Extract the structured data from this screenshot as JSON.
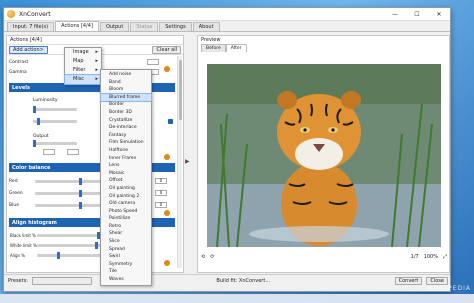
{
  "window": {
    "title": "XnConvert",
    "minimize": "—",
    "maximize": "☐",
    "close": "✕"
  },
  "tabs": [
    {
      "label": "Input: 7 file(s)"
    },
    {
      "label": "Actions [4/4]"
    },
    {
      "label": "Output"
    },
    {
      "label": "Status"
    },
    {
      "label": "Settings"
    },
    {
      "label": "About"
    }
  ],
  "actions_panel": {
    "header": "Actions [4/4]",
    "add_action": "Add action>",
    "clear_all": "Clear all",
    "contrast_label": "Contrast",
    "gamma_label": "Gamma",
    "levels": {
      "title": "Levels",
      "luminosity": "Luminosity",
      "output": "Output"
    },
    "color_balance": {
      "title": "Color balance",
      "red": "Red",
      "green": "Green",
      "blue": "Blue",
      "red_value": "0",
      "green_value": "0",
      "blue_value": "0"
    },
    "align_histogram": {
      "title": "Align histogram",
      "black_limit": "Black limit %",
      "white_limit": "White limit %",
      "align": "Align %"
    },
    "enabled_label": "Enabled"
  },
  "main_menu": {
    "items": [
      {
        "label": "Image"
      },
      {
        "label": "Map"
      },
      {
        "label": "Filter"
      },
      {
        "label": "Misc"
      }
    ]
  },
  "sub_menu": {
    "items": [
      {
        "label": "Add noise"
      },
      {
        "label": "Band"
      },
      {
        "label": "Bloom"
      },
      {
        "label": "Blurred frame"
      },
      {
        "label": "Border"
      },
      {
        "label": "Border 3D"
      },
      {
        "label": "Crystallize"
      },
      {
        "label": "De-interlace"
      },
      {
        "label": "Fantasy"
      },
      {
        "label": "Film Simulation"
      },
      {
        "label": "Halftone"
      },
      {
        "label": "Inner Frame"
      },
      {
        "label": "Lens"
      },
      {
        "label": "Mosaic"
      },
      {
        "label": "Offset"
      },
      {
        "label": "Oil painting"
      },
      {
        "label": "Oil painting 2"
      },
      {
        "label": "Old camera"
      },
      {
        "label": "Photo Speed"
      },
      {
        "label": "Pointillize"
      },
      {
        "label": "Retro"
      },
      {
        "label": "Shear"
      },
      {
        "label": "Slice"
      },
      {
        "label": "Spread"
      },
      {
        "label": "Swirl"
      },
      {
        "label": "Symmetry"
      },
      {
        "label": "Tile"
      },
      {
        "label": "Waves"
      }
    ],
    "selected": "Blurred frame"
  },
  "preview": {
    "title": "Preview",
    "tabs": [
      {
        "label": "Before"
      },
      {
        "label": "After"
      }
    ],
    "page": "1/7",
    "zoom": "100%"
  },
  "bottom": {
    "presets_label": "Presets:",
    "convert": "Convert",
    "close": "Close",
    "status": "Build fit: XnConvert..."
  },
  "watermark": "SOFTPEDIA",
  "colors": {
    "accent": "#1f63b3",
    "section": "#1f63b3",
    "menu_highlight": "#cfe2fb"
  }
}
